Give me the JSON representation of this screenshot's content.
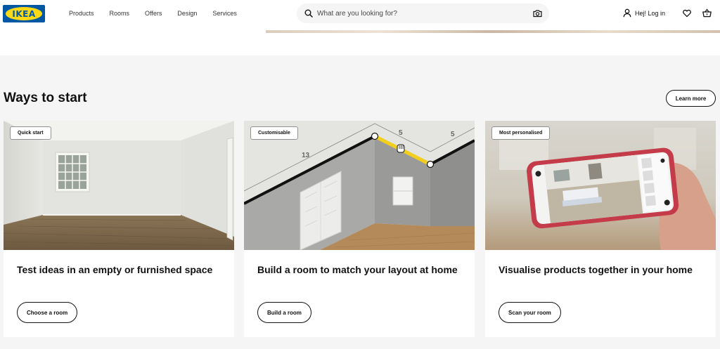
{
  "header": {
    "logo_text": "IKEA",
    "nav": [
      {
        "label": "Products"
      },
      {
        "label": "Rooms"
      },
      {
        "label": "Offers"
      },
      {
        "label": "Design"
      },
      {
        "label": "Services"
      }
    ],
    "search": {
      "placeholder": "What are you looking for?",
      "icon": "search-icon",
      "camera_icon": "camera-icon"
    },
    "login_label": "Hej! Log in",
    "icons": [
      "user-icon",
      "heart-icon",
      "cart-icon"
    ]
  },
  "section": {
    "title": "Ways to start",
    "learn_more_label": "Learn more",
    "cards": [
      {
        "badge": "Quick start",
        "title": "Test ideas in an empty or furnished space",
        "button": "Choose a room"
      },
      {
        "badge": "Customisable",
        "title": "Build a room to match your layout at home",
        "button": "Build a room",
        "dimensions": [
          "13",
          "5",
          "5"
        ]
      },
      {
        "badge": "Most personalised",
        "title": "Visualise products together in your home",
        "button": "Scan your room"
      }
    ]
  },
  "colors": {
    "brand_blue": "#0058a3",
    "brand_yellow": "#fbd914",
    "section_bg": "#f5f5f5",
    "highlight_yellow": "#f2cf1d"
  }
}
